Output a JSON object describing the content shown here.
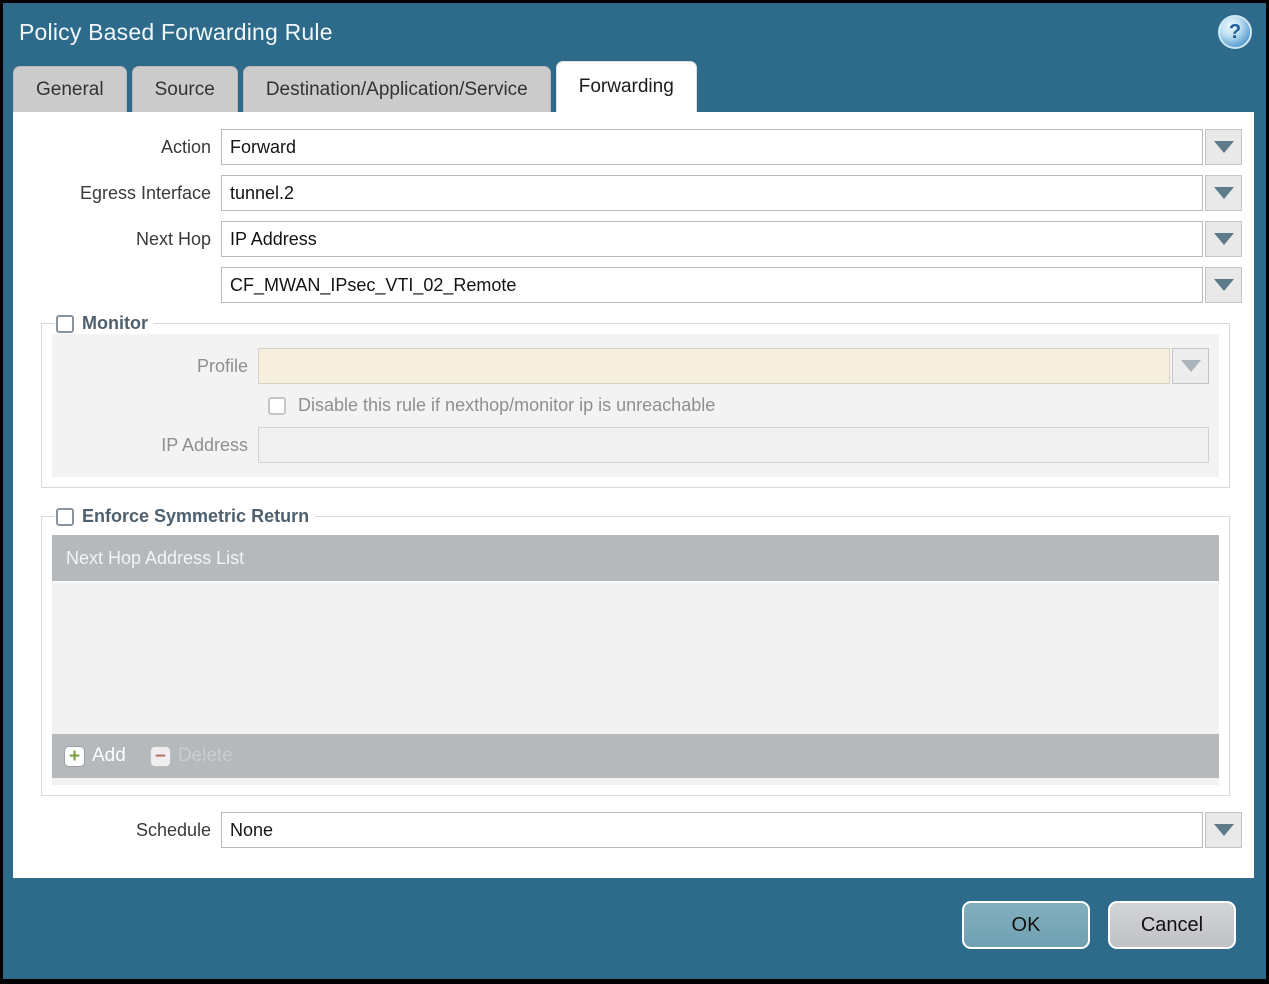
{
  "window": {
    "title": "Policy Based Forwarding Rule"
  },
  "tabs": [
    {
      "label": "General",
      "active": false
    },
    {
      "label": "Source",
      "active": false
    },
    {
      "label": "Destination/Application/Service",
      "active": false
    },
    {
      "label": "Forwarding",
      "active": true
    }
  ],
  "form": {
    "action": {
      "label": "Action",
      "value": "Forward"
    },
    "egress_interface": {
      "label": "Egress Interface",
      "value": "tunnel.2"
    },
    "next_hop": {
      "label": "Next Hop",
      "value": "IP Address"
    },
    "next_hop_address": {
      "value": "CF_MWAN_IPsec_VTI_02_Remote"
    },
    "schedule": {
      "label": "Schedule",
      "value": "None"
    }
  },
  "monitor": {
    "label": "Monitor",
    "checked": false,
    "profile": {
      "label": "Profile",
      "value": ""
    },
    "disable_rule": {
      "label": "Disable this rule if nexthop/monitor ip is unreachable",
      "checked": false
    },
    "ip_address": {
      "label": "IP Address",
      "value": ""
    }
  },
  "enforce_symmetric_return": {
    "label": "Enforce Symmetric Return",
    "checked": false,
    "table": {
      "header": "Next Hop Address List",
      "rows": []
    },
    "toolbar": {
      "add_label": "Add",
      "delete_label": "Delete"
    }
  },
  "footer": {
    "ok_label": "OK",
    "cancel_label": "Cancel"
  },
  "icons": {
    "help": "?",
    "add": "+",
    "delete": "−"
  },
  "colors": {
    "titlebar_teal": "#2e6b8a",
    "tab_inactive": "#cbcbcb",
    "tab_active": "#ffffff",
    "caret": "#5d7b8b",
    "fieldset_inner_gray": "#f3f3f3",
    "profile_disabled_bg": "#f6efdd",
    "table_header_gray": "#b5b9bc",
    "add_icon_green": "#7b9e3e",
    "delete_icon_red": "#b4766b",
    "ok_button": "#78a7b8",
    "cancel_button": "#c9cbce",
    "help_icon_blue": "#4a90c4"
  }
}
